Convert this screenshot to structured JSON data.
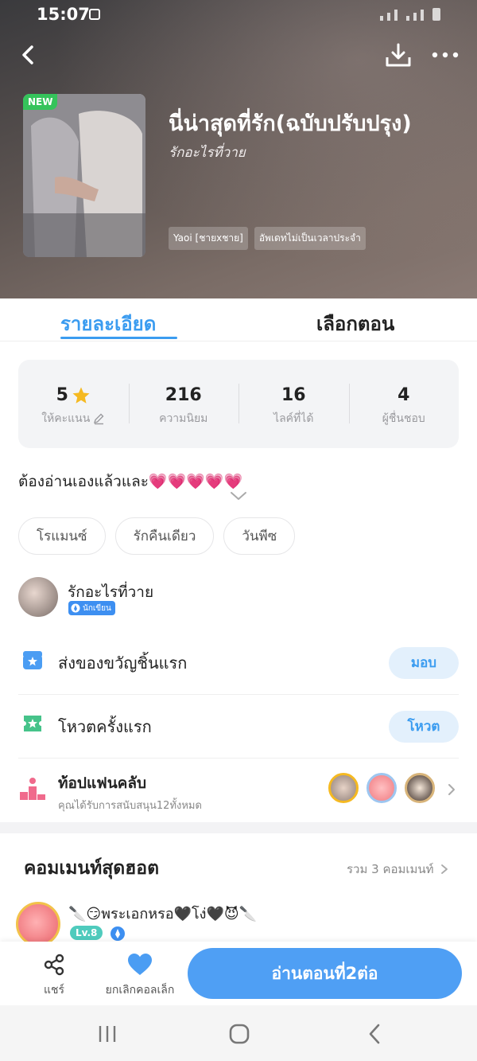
{
  "status_bar": {
    "time": "15:07"
  },
  "novel": {
    "new_badge": "NEW",
    "title": "นี่น่าสุดที่รัก(ฉบับปรับปรุง)",
    "author": "รักอะไรที่วาย",
    "tags": [
      "Yaoi [ชายxชาย]",
      "อัพเดทไม่เป็นเวลาประจำ"
    ]
  },
  "tabs": {
    "details": "รายละเอียด",
    "episodes": "เลือกตอน"
  },
  "stats": [
    {
      "value": "5",
      "label": "ให้คะแนน",
      "icon": "star-icon"
    },
    {
      "value": "216",
      "label": "ความนิยม"
    },
    {
      "value": "16",
      "label": "ไลค์ที่ได้"
    },
    {
      "value": "4",
      "label": "ผู้ชื่นชอบ"
    }
  ],
  "synopsis": "ต้องอ่านเองแล้วและ💗💗💗💗💗",
  "genres": [
    "โรแมนซ์",
    "รักคืนเดียว",
    "วันพีซ"
  ],
  "writer": {
    "name": "รักอะไรที่วาย",
    "badge": "นักเขียน"
  },
  "gift": {
    "label": "ส่งของขวัญชิ้นแรก",
    "button": "มอบ"
  },
  "vote": {
    "label": "โหวตครั้งแรก",
    "button": "โหวต"
  },
  "fanclub": {
    "title": "ท้อปแฟนคลับ",
    "subtitle": "คุณได้รับการสนับสนุน12ทั้งหมด"
  },
  "comments": {
    "title": "คอมเมนท์สุดฮอต",
    "count": "รวม 3 คอมเมนท์",
    "first": {
      "name": "🔪😏พระเอกหรอ🖤โง่🖤😈🔪",
      "level": "Lv.8"
    }
  },
  "bottom": {
    "share": "แชร์",
    "favorite": "ยกเลิกคอลเล็ก",
    "read": "อ่านตอนที่2ต่อ"
  },
  "colors": {
    "accent": "#3b9cf0",
    "new_badge": "#35c35b",
    "star": "#f5b921",
    "read_button": "#4f9ff4"
  }
}
